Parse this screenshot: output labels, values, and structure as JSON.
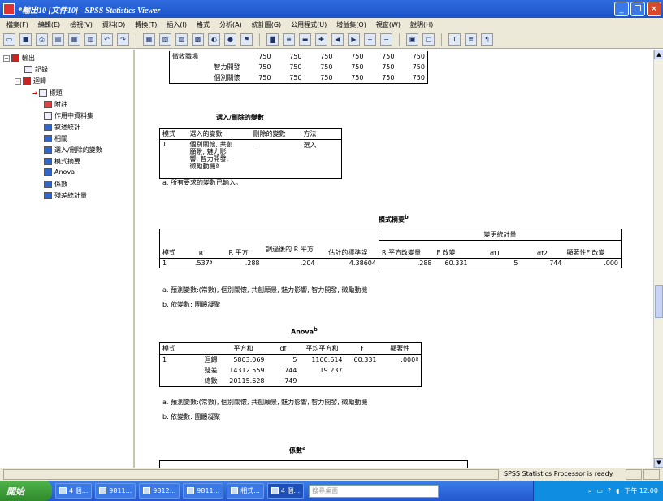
{
  "window": {
    "title": "*輸出10 [文件10] - SPSS Statistics Viewer"
  },
  "menu": [
    "檔案(F)",
    "編輯(E)",
    "檢視(V)",
    "資料(D)",
    "轉換(T)",
    "插入(I)",
    "格式",
    "分析(A)",
    "統計圖(G)",
    "公用程式(U)",
    "增益集(O)",
    "視窗(W)",
    "說明(H)"
  ],
  "outline": {
    "root": "輸出",
    "log": "記錄",
    "regression": "迴歸",
    "children": [
      "標題",
      "附註",
      "作用中資料集",
      "敘述統計",
      "相關",
      "選入/刪除的變數",
      "模式摘要",
      "Anova",
      "係數",
      "殘差統計量"
    ]
  },
  "top_table": {
    "rows": [
      {
        "label": "徵收職場",
        "values": [
          "750",
          "750",
          "750",
          "750",
          "750",
          "750"
        ]
      },
      {
        "label": "智力開發",
        "values": [
          "750",
          "750",
          "750",
          "750",
          "750",
          "750"
        ]
      },
      {
        "label": "個別關懷",
        "values": [
          "750",
          "750",
          "750",
          "750",
          "750",
          "750"
        ]
      }
    ]
  },
  "entered": {
    "title": "選入/刪除的變數",
    "headers": [
      "模式",
      "選入的變數",
      "刪除的變數",
      "方法"
    ],
    "row": {
      "model": "1",
      "entered_lines": [
        "個別關懷, 共創",
        "願景, 魅力影",
        "響, 智力開發,",
        "徵勵動機ª"
      ],
      "removed": ".",
      "method": "選入"
    },
    "note": "a. 所有要求的變數已輸入。"
  },
  "summary": {
    "title": "模式摘要",
    "title_sup": "b",
    "group_header": "變更統計量",
    "headers": [
      "模式",
      "R",
      "R 平方",
      "調過後的 R 平方",
      "估計的標準誤",
      "R 平方改變量",
      "F 改變",
      "df1",
      "df2",
      "顯著性F 改變"
    ],
    "row": [
      "1",
      ".537ª",
      ".288",
      ".204",
      "4.38604",
      ".288",
      "60.331",
      "5",
      "744",
      ".000"
    ],
    "note_a": "a. 預測變數:(常數), 個別關懷, 共創願景, 魅力影響, 智力開發, 徵勵動機",
    "note_b": "b. 依變數: 團體凝聚"
  },
  "anova": {
    "title": "Anova",
    "title_sup": "b",
    "headers": [
      "模式",
      "",
      "平方和",
      "df",
      "平均平方和",
      "F",
      "顯著性"
    ],
    "rows": [
      [
        "1",
        "迴歸",
        "5803.069",
        "5",
        "1160.614",
        "60.331",
        ".000ª"
      ],
      [
        "",
        "殘差",
        "14312.559",
        "744",
        "19.237",
        "",
        ""
      ],
      [
        "",
        "總數",
        "20115.628",
        "749",
        "",
        "",
        ""
      ]
    ],
    "note_a": "a. 預測變數:(常數), 個別關懷, 共創願景, 魅力影響, 智力開發, 徵勵動機",
    "note_b": "b. 依變數: 團體凝聚"
  },
  "coef": {
    "title": "係數",
    "title_sup": "a"
  },
  "status": {
    "processor": "SPSS Statistics  Processor is ready"
  },
  "taskbar": {
    "start": "開始",
    "tasks": [
      "4 個...",
      "9811...",
      "9812...",
      "9811...",
      "相式...",
      "4 個..."
    ],
    "search_placeholder": "搜尋桌面",
    "clock": "下午 12:00"
  }
}
